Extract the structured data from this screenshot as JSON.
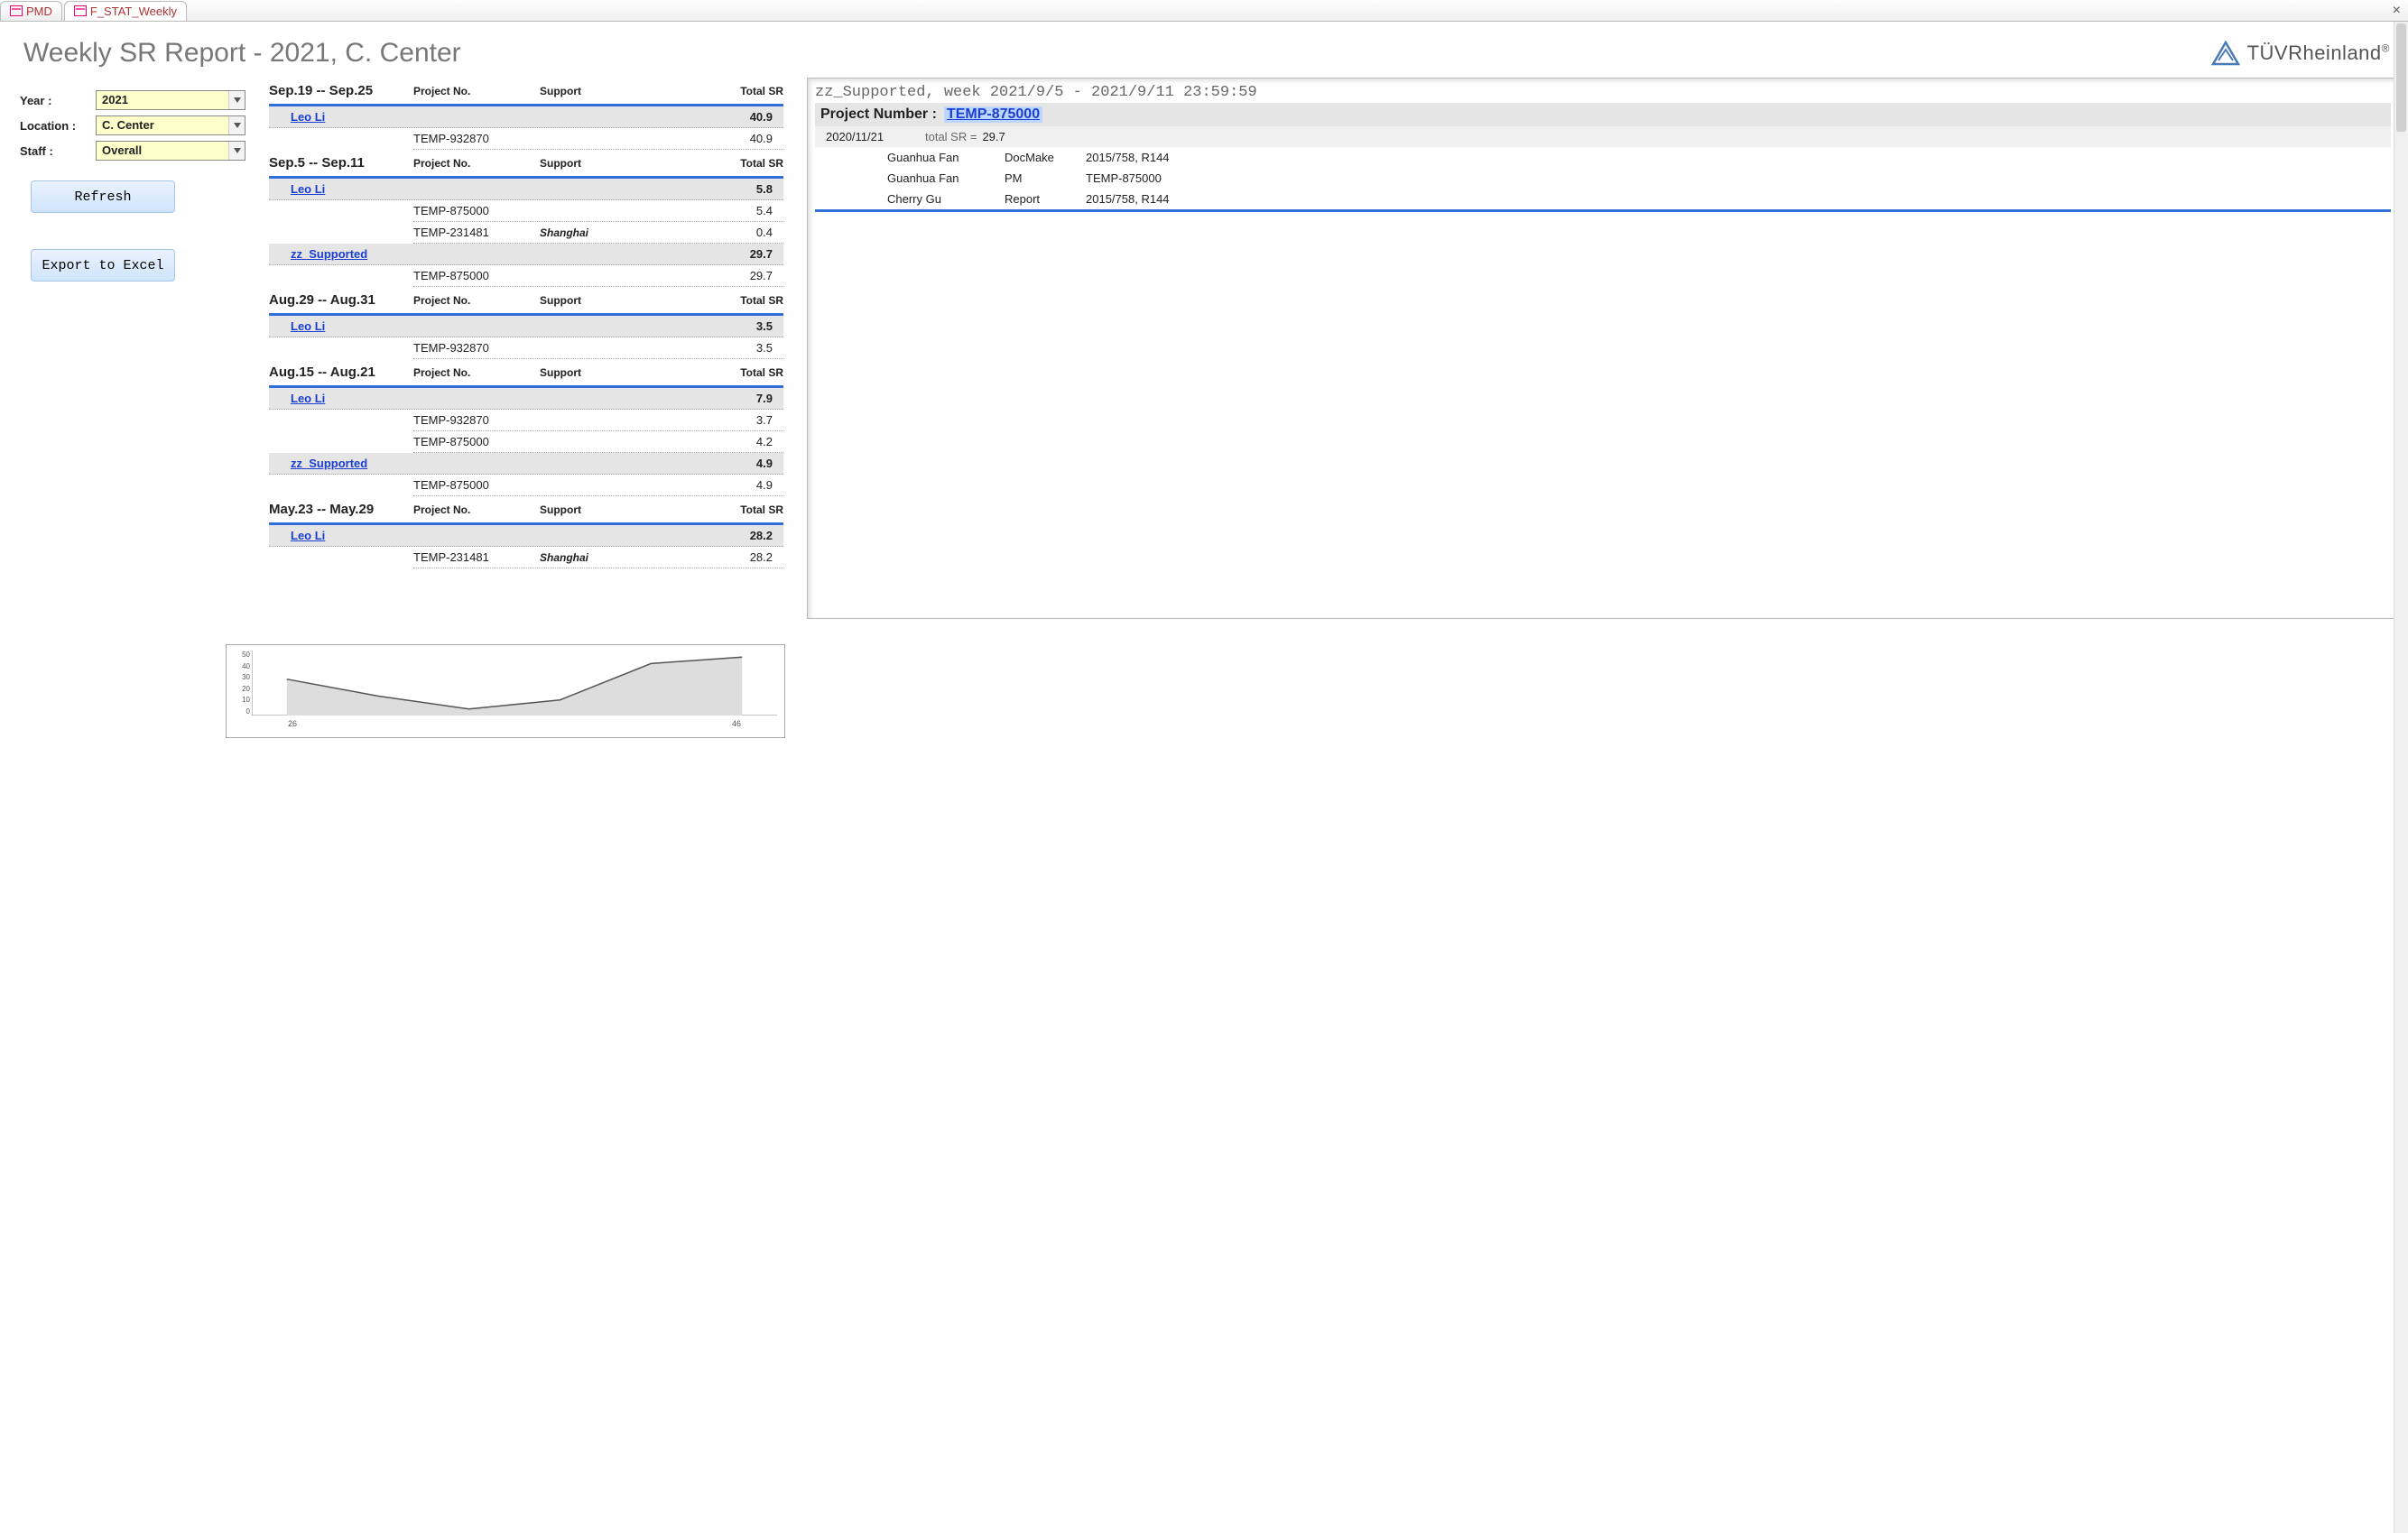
{
  "tabs": [
    {
      "label": "PMD",
      "active": false
    },
    {
      "label": "F_STAT_Weekly",
      "active": true
    }
  ],
  "title": "Weekly SR Report - 2021, C. Center",
  "brand": "TÜVRheinland",
  "filters": {
    "year_label": "Year :",
    "year_value": "2021",
    "location_label": "Location :",
    "location_value": "C. Center",
    "staff_label": "Staff :",
    "staff_value": "Overall"
  },
  "buttons": {
    "refresh": "Refresh",
    "export": "Export to Excel"
  },
  "columns": {
    "project": "Project No.",
    "support": "Support",
    "total": "Total SR"
  },
  "weeks": [
    {
      "range": "Sep.19  --  Sep.25",
      "groups": [
        {
          "staff": "Leo Li",
          "total": "40.9",
          "rows": [
            {
              "proj": "TEMP-932870",
              "supp": "",
              "tot": "40.9"
            }
          ]
        }
      ]
    },
    {
      "range": "Sep.5  --  Sep.11",
      "groups": [
        {
          "staff": "Leo Li",
          "total": "5.8",
          "rows": [
            {
              "proj": "TEMP-875000",
              "supp": "",
              "tot": "5.4"
            },
            {
              "proj": "TEMP-231481",
              "supp": "Shanghai",
              "tot": "0.4"
            }
          ]
        },
        {
          "staff": "zz_Supported",
          "total": "29.7",
          "rows": [
            {
              "proj": "TEMP-875000",
              "supp": "",
              "tot": "29.7"
            }
          ]
        }
      ]
    },
    {
      "range": "Aug.29  --  Aug.31",
      "groups": [
        {
          "staff": "Leo Li",
          "total": "3.5",
          "rows": [
            {
              "proj": "TEMP-932870",
              "supp": "",
              "tot": "3.5"
            }
          ]
        }
      ]
    },
    {
      "range": "Aug.15  --  Aug.21",
      "groups": [
        {
          "staff": "Leo Li",
          "total": "7.9",
          "rows": [
            {
              "proj": "TEMP-932870",
              "supp": "",
              "tot": "3.7"
            },
            {
              "proj": "TEMP-875000",
              "supp": "",
              "tot": "4.2"
            }
          ]
        },
        {
          "staff": "zz_Supported",
          "total": "4.9",
          "rows": [
            {
              "proj": "TEMP-875000",
              "supp": "",
              "tot": "4.9"
            }
          ]
        }
      ]
    },
    {
      "range": "May.23  --  May.29",
      "groups": [
        {
          "staff": "Leo Li",
          "total": "28.2",
          "rows": [
            {
              "proj": "TEMP-231481",
              "supp": "Shanghai",
              "tot": "28.2"
            }
          ]
        }
      ]
    }
  ],
  "detail": {
    "title": "zz_Supported, week 2021/9/5 - 2021/9/11 23:59:59",
    "pn_label": "Project Number :",
    "pn_value": "TEMP-875000",
    "sub_date": "2020/11/21",
    "sub_label": "total SR =",
    "sub_value": "29.7",
    "activities": [
      {
        "who": "Guanhua Fan",
        "what": "DocMake",
        "ref": "2015/758, R144"
      },
      {
        "who": "Guanhua Fan",
        "what": "PM",
        "ref": "TEMP-875000"
      },
      {
        "who": "Cherry Gu",
        "what": "Report",
        "ref": "2015/758, R144"
      }
    ]
  },
  "chart_data": {
    "type": "area",
    "x": [
      26,
      30,
      34,
      38,
      42,
      46
    ],
    "values": [
      28,
      15,
      5,
      12,
      40,
      45
    ],
    "ylim": [
      0,
      50
    ],
    "yticks": [
      0,
      10,
      20,
      30,
      40,
      50
    ],
    "xticks": [
      26,
      46
    ]
  }
}
